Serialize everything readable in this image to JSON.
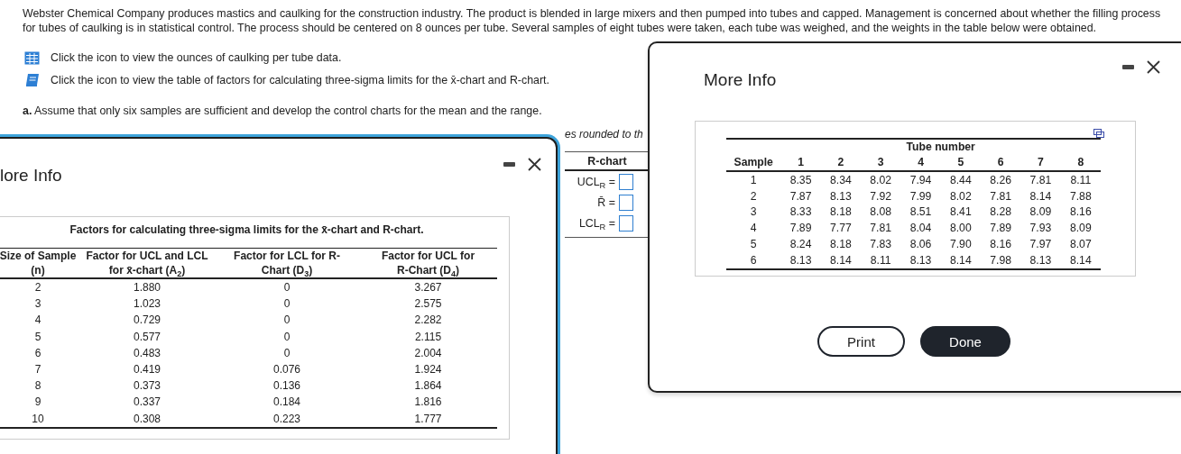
{
  "problem": {
    "text": "Webster Chemical Company produces mastics and caulking for the construction industry. The product is blended in large mixers and then pumped into tubes and capped. Management is concerned about whether the filling process for tubes of caulking is in statistical control. The process should be centered on 8 ounces per tube. Several samples of eight tubes were taken, each tube was weighed, and the weights in the table below were obtained.",
    "resources": [
      {
        "kind": "table",
        "text": "Click the icon to view the ounces of caulking per tube data."
      },
      {
        "kind": "book",
        "text": "Click the icon to view the table of factors for calculating three-sigma limits for the x̄-chart and R-chart."
      }
    ],
    "part_a": "**a.** Assume that only six samples are sufficient and develop the control charts for the mean and the range."
  },
  "answer_area": {
    "note": "es rounded to th",
    "r_chart": {
      "title": "R-chart",
      "rows": [
        {
          "label": "UCL$_{R}$ ="
        },
        {
          "label": "R̄ ="
        },
        {
          "label": "LCL$_{R}$ ="
        }
      ]
    }
  },
  "factors_dialog": {
    "title": "lore Info",
    "table": {
      "caption": "Factors for calculating three-sigma limits for the x̄-chart and R-chart.",
      "columns": [
        "Size of Sample (n)",
        "Factor for UCL and LCL for x̄-chart (A$_{2}$)",
        "Factor for LCL for R-Chart (D$_{3}$)",
        "Factor for UCL for R-Chart (D$_{4}$)"
      ],
      "rows": [
        [
          "2",
          "1.880",
          "0",
          "3.267"
        ],
        [
          "3",
          "1.023",
          "0",
          "2.575"
        ],
        [
          "4",
          "0.729",
          "0",
          "2.282"
        ],
        [
          "5",
          "0.577",
          "0",
          "2.115"
        ],
        [
          "6",
          "0.483",
          "0",
          "2.004"
        ],
        [
          "7",
          "0.419",
          "0.076",
          "1.924"
        ],
        [
          "8",
          "0.373",
          "0.136",
          "1.864"
        ],
        [
          "9",
          "0.337",
          "0.184",
          "1.816"
        ],
        [
          "10",
          "0.308",
          "0.223",
          "1.777"
        ]
      ]
    }
  },
  "data_dialog": {
    "title": "More Info",
    "table": {
      "group_header": "Tube number",
      "columns": [
        "Sample",
        "1",
        "2",
        "3",
        "4",
        "5",
        "6",
        "7",
        "8"
      ],
      "rows": [
        [
          "1",
          "8.35",
          "8.34",
          "8.02",
          "7.94",
          "8.44",
          "8.26",
          "7.81",
          "8.11"
        ],
        [
          "2",
          "7.87",
          "8.13",
          "7.92",
          "7.99",
          "8.02",
          "7.81",
          "8.14",
          "7.88"
        ],
        [
          "3",
          "8.33",
          "8.18",
          "8.08",
          "8.51",
          "8.41",
          "8.28",
          "8.09",
          "8.16"
        ],
        [
          "4",
          "7.89",
          "7.77",
          "7.81",
          "8.04",
          "8.00",
          "7.89",
          "7.93",
          "8.09"
        ],
        [
          "5",
          "8.24",
          "8.18",
          "7.83",
          "8.06",
          "7.90",
          "8.16",
          "7.97",
          "8.07"
        ],
        [
          "6",
          "8.13",
          "8.14",
          "8.11",
          "8.13",
          "8.14",
          "7.98",
          "8.13",
          "8.14"
        ]
      ]
    },
    "buttons": [
      {
        "label": "Print",
        "kind": "secondary"
      },
      {
        "label": "Done",
        "kind": "primary"
      }
    ]
  }
}
